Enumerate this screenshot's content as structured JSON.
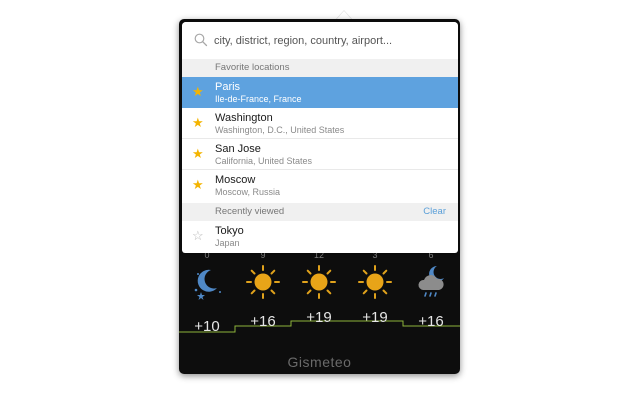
{
  "search": {
    "placeholder": "city, district, region, country, airport...",
    "value": ""
  },
  "favorites": {
    "header": "Favorite locations",
    "items": [
      {
        "city": "Paris",
        "region": "Ile-de-France, France",
        "selected": true
      },
      {
        "city": "Washington",
        "region": "Washington, D.C., United States",
        "selected": false
      },
      {
        "city": "San Jose",
        "region": "California, United States",
        "selected": false
      },
      {
        "city": "Moscow",
        "region": "Moscow, Russia",
        "selected": false
      }
    ]
  },
  "recent": {
    "header": "Recently viewed",
    "clear_label": "Clear",
    "items": [
      {
        "city": "Tokyo",
        "region": "Japan"
      }
    ]
  },
  "forecast": {
    "hours": [
      "0",
      "9",
      "12",
      "3",
      "6"
    ],
    "icons": [
      "moon-stars-icon",
      "sun-icon",
      "sun-icon",
      "sun-icon",
      "moon-cloud-rain-icon"
    ],
    "temperatures": [
      "+10",
      "+16",
      "+19",
      "+19",
      "+16"
    ]
  },
  "brand": "Gismeteo",
  "colors": {
    "selection": "#5ea2df",
    "star": "#f4b400",
    "clear_link": "#5a9fd8",
    "temp_line": "#8db33a",
    "widget_bg": "#0d0d0d"
  }
}
